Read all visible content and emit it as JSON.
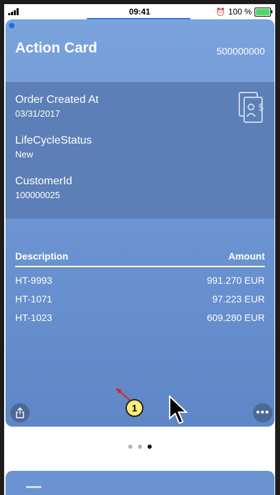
{
  "status_bar": {
    "time": "09:41",
    "battery_text": "100 %",
    "battery_level": 1.0,
    "battery_color": "#4cd964"
  },
  "card": {
    "title": "Action Card",
    "number": "500000000",
    "accent_color": "#6b93d1",
    "icon": "document-money-icon",
    "fields": [
      {
        "label": "Order Created At",
        "value": "03/31/2017"
      },
      {
        "label": "LifeCycleStatus",
        "value": "New"
      },
      {
        "label": "CustomerId",
        "value": "100000025"
      }
    ],
    "table": {
      "headers": [
        "Description",
        "Amount"
      ],
      "rows": [
        [
          "HT-9993",
          "991.270 EUR"
        ],
        [
          "HT-1071",
          "97.223 EUR"
        ],
        [
          "HT-1023",
          "609.280 EUR"
        ]
      ]
    },
    "share_icon": "share-icon",
    "more_icon": "more-icon"
  },
  "annotation": {
    "badge": "1",
    "color": "#ffee7a"
  },
  "pager": {
    "count": 3,
    "active": 3
  }
}
